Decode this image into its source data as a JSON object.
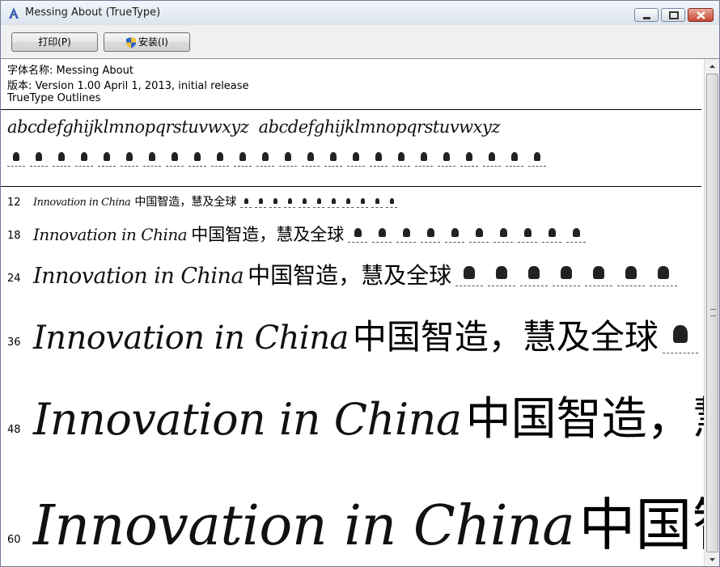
{
  "window": {
    "title": "Messing About (TrueType)",
    "accent": "#dbe3ee",
    "close_color": "#c7452f"
  },
  "toolbar": {
    "print_label": "打印(P)",
    "install_label": "安装(I)"
  },
  "info": {
    "font_name": "字体名称: Messing About",
    "version": "版本: Version 1.00 April 1, 2013, initial release",
    "outlines": "TrueType Outlines"
  },
  "alphabet": {
    "lower": "abcdefghijklmnopqrstuvwxyz",
    "upper": "abcdefghijklmnopqrstuvwxyz"
  },
  "samples": {
    "latin": "Innovation in China",
    "cjk": "中国智造，慧及全球",
    "sizes": [
      "12",
      "18",
      "24",
      "36",
      "48",
      "60"
    ]
  },
  "icons": [
    "app-font-icon",
    "minimize-icon",
    "maximize-icon",
    "close-icon",
    "uac-shield-icon",
    "scroll-up-icon",
    "scroll-down-icon"
  ]
}
